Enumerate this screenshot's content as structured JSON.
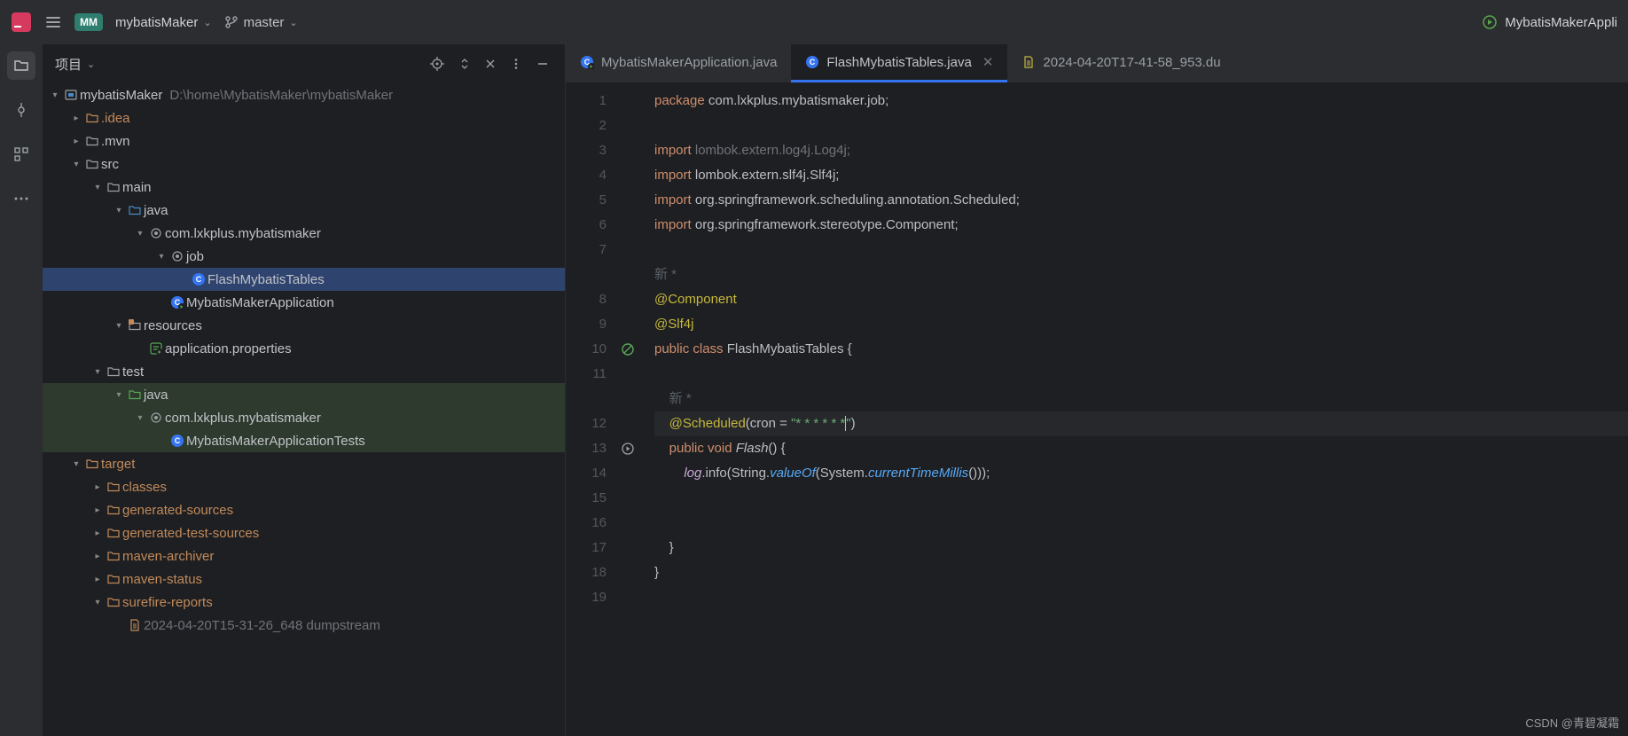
{
  "topbar": {
    "project_badge": "MM",
    "project_name": "mybatisMaker",
    "branch_name": "master",
    "run_config": "MybatisMakerAppli"
  },
  "sidebar": {
    "header_label": "项目",
    "root": {
      "name": "mybatisMaker",
      "path": "D:\\home\\MybatisMaker\\mybatisMaker"
    },
    "rows": [
      {
        "ind": 0,
        "arrow": "down",
        "icon": "module",
        "label": "mybatisMaker",
        "path": "D:\\home\\MybatisMaker\\mybatisMaker"
      },
      {
        "ind": 1,
        "arrow": "right",
        "icon": "folder",
        "label": ".idea",
        "exc": true
      },
      {
        "ind": 1,
        "arrow": "right",
        "icon": "folder",
        "label": ".mvn"
      },
      {
        "ind": 1,
        "arrow": "down",
        "icon": "folder",
        "label": "src"
      },
      {
        "ind": 2,
        "arrow": "down",
        "icon": "folder",
        "label": "main"
      },
      {
        "ind": 3,
        "arrow": "down",
        "icon": "folder-src",
        "label": "java"
      },
      {
        "ind": 4,
        "arrow": "down",
        "icon": "package",
        "label": "com.lxkplus.mybatismaker"
      },
      {
        "ind": 5,
        "arrow": "down",
        "icon": "package",
        "label": "job"
      },
      {
        "ind": 6,
        "arrow": "",
        "icon": "class",
        "label": "FlashMybatisTables",
        "selected": true
      },
      {
        "ind": 5,
        "arrow": "",
        "icon": "class-run",
        "label": "MybatisMakerApplication"
      },
      {
        "ind": 3,
        "arrow": "down",
        "icon": "folder-res",
        "label": "resources"
      },
      {
        "ind": 4,
        "arrow": "",
        "icon": "props",
        "label": "application.properties"
      },
      {
        "ind": 2,
        "arrow": "down",
        "icon": "folder",
        "label": "test"
      },
      {
        "ind": 3,
        "arrow": "down",
        "icon": "folder-test",
        "label": "java",
        "green": true
      },
      {
        "ind": 4,
        "arrow": "down",
        "icon": "package",
        "label": "com.lxkplus.mybatismaker",
        "green": true
      },
      {
        "ind": 5,
        "arrow": "",
        "icon": "class",
        "label": "MybatisMakerApplicationTests",
        "green": true
      },
      {
        "ind": 1,
        "arrow": "down",
        "icon": "folder",
        "label": "target",
        "exc": true
      },
      {
        "ind": 2,
        "arrow": "right",
        "icon": "folder",
        "label": "classes",
        "exc": true
      },
      {
        "ind": 2,
        "arrow": "right",
        "icon": "folder",
        "label": "generated-sources",
        "exc": true
      },
      {
        "ind": 2,
        "arrow": "right",
        "icon": "folder",
        "label": "generated-test-sources",
        "exc": true
      },
      {
        "ind": 2,
        "arrow": "right",
        "icon": "folder",
        "label": "maven-archiver",
        "exc": true
      },
      {
        "ind": 2,
        "arrow": "right",
        "icon": "folder",
        "label": "maven-status",
        "exc": true
      },
      {
        "ind": 2,
        "arrow": "down",
        "icon": "folder",
        "label": "surefire-reports",
        "exc": true
      },
      {
        "ind": 3,
        "arrow": "",
        "icon": "file",
        "label": "2024-04-20T15-31-26_648 dumpstream",
        "exc": true,
        "dim": true
      }
    ]
  },
  "tabs": [
    {
      "icon": "class-run",
      "label": "MybatisMakerApplication.java",
      "active": false
    },
    {
      "icon": "class",
      "label": "FlashMybatisTables.java",
      "active": true,
      "closable": true
    },
    {
      "icon": "file-txt",
      "label": "2024-04-20T17-41-58_953.du",
      "active": false
    }
  ],
  "code": {
    "lines": [
      {
        "n": 1,
        "html": "<span class='kw'>package</span> <span class='id'>com.lxkplus.mybatismaker.job</span>;"
      },
      {
        "n": 2,
        "html": ""
      },
      {
        "n": 3,
        "html": "<span class='kw'>import</span> <span class='grey'>lombok.extern.log4j.Log4j;</span>"
      },
      {
        "n": 4,
        "html": "<span class='kw'>import</span> <span class='id'>lombok.extern.slf4j.</span><span class='cls'>Slf4j</span>;"
      },
      {
        "n": 5,
        "html": "<span class='kw'>import</span> <span class='id'>org.springframework.scheduling.annotation.</span><span class='cls'>Scheduled</span>;"
      },
      {
        "n": 6,
        "html": "<span class='kw'>import</span> <span class='id'>org.springframework.stereotype.</span><span class='cls'>Component</span>;"
      },
      {
        "n": 7,
        "html": ""
      },
      {
        "n": null,
        "html": "<span class='pale'>新 *</span>"
      },
      {
        "n": 8,
        "html": "<span class='ann'>@Component</span>"
      },
      {
        "n": 9,
        "html": "<span class='ann'>@Slf4j</span>"
      },
      {
        "n": 10,
        "html": "<span class='kw'>public class</span> <span class='cls'>FlashMybatisTables</span> {",
        "gutter": "no-entry"
      },
      {
        "n": 11,
        "html": ""
      },
      {
        "n": null,
        "html": "    <span class='pale'>新 *</span>"
      },
      {
        "n": 12,
        "html": "    <span class='ann'>@Scheduled</span>(<span class='id'>cron</span> = <span class='str'>\"* * * * * *<span class='caret'></span>\"</span>)",
        "hl": true
      },
      {
        "n": 13,
        "html": "    <span class='kw'>public void</span> <span class='fn'>Flash</span>() {",
        "gutter": "run"
      },
      {
        "n": 14,
        "html": "        <span class='var'>log</span>.info(String.<span class='mtd'>valueOf</span>(System.<span class='mtd'>currentTimeMillis</span>()));"
      },
      {
        "n": 15,
        "html": ""
      },
      {
        "n": 16,
        "html": ""
      },
      {
        "n": 17,
        "html": "    }"
      },
      {
        "n": 18,
        "html": "}"
      },
      {
        "n": 19,
        "html": ""
      }
    ]
  },
  "watermark": "CSDN @青碧凝霜"
}
